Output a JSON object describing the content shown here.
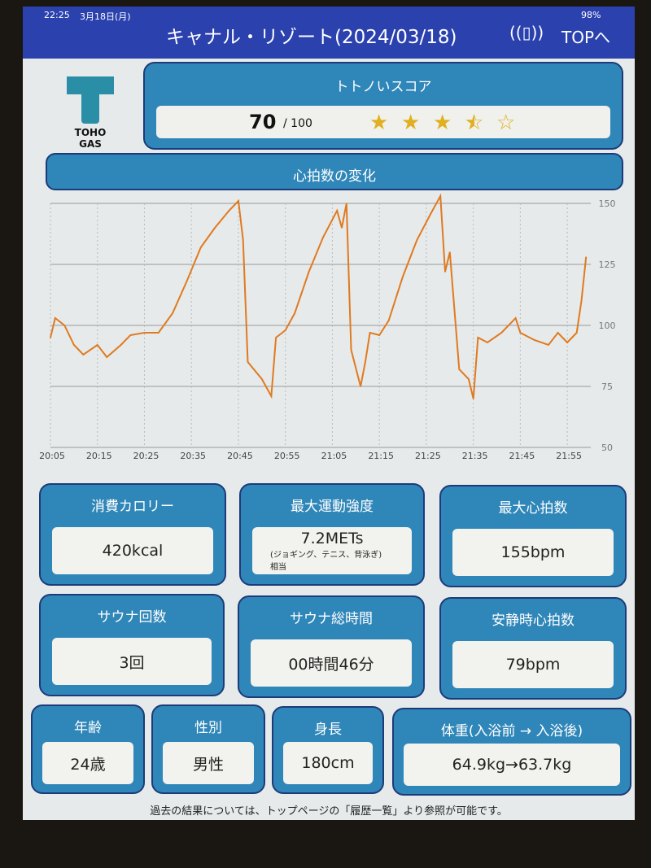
{
  "status": {
    "time": "22:25",
    "date": "3月18日(月)",
    "battery": "98%"
  },
  "header": {
    "title": "キャナル・リゾート(2024/03/18)",
    "watch_icon": "smartwatch-icon",
    "top_label": "TOPへ"
  },
  "logo": {
    "text": "TOHO GAS"
  },
  "score": {
    "title": "トトノいスコア",
    "value": "70",
    "max": "/ 100",
    "stars": 3.5,
    "star_color": "#e0b020"
  },
  "chart_section": {
    "title": "心拍数の変化"
  },
  "chart_data": {
    "type": "line",
    "color": "#e07a20",
    "ylim": [
      50,
      150
    ],
    "yticks": [
      50,
      75,
      100,
      125,
      150
    ],
    "xticks": [
      "20:05",
      "20:15",
      "20:25",
      "20:35",
      "20:45",
      "20:55",
      "21:05",
      "21:15",
      "21:25",
      "21:35",
      "21:45",
      "21:55"
    ],
    "x": [
      "20:05",
      "20:06",
      "20:08",
      "20:10",
      "20:12",
      "20:15",
      "20:17",
      "20:20",
      "20:22",
      "20:25",
      "20:28",
      "20:31",
      "20:34",
      "20:37",
      "20:40",
      "20:43",
      "20:45",
      "20:46",
      "20:47",
      "20:50",
      "20:52",
      "20:53",
      "20:55",
      "20:57",
      "21:00",
      "21:03",
      "21:06",
      "21:07",
      "21:08",
      "21:09",
      "21:11",
      "21:12",
      "21:13",
      "21:15",
      "21:17",
      "21:20",
      "21:23",
      "21:26",
      "21:28",
      "21:29",
      "21:30",
      "21:32",
      "21:34",
      "21:35",
      "21:36",
      "21:38",
      "21:41",
      "21:44",
      "21:45",
      "21:48",
      "21:51",
      "21:53",
      "21:55",
      "21:57",
      "21:58",
      "21:59"
    ],
    "y": [
      95,
      103,
      100,
      92,
      88,
      92,
      87,
      92,
      96,
      97,
      97,
      105,
      118,
      132,
      140,
      147,
      151,
      135,
      85,
      78,
      71,
      95,
      98,
      105,
      122,
      136,
      147,
      140,
      150,
      90,
      75,
      85,
      97,
      96,
      102,
      120,
      135,
      146,
      153,
      122,
      130,
      82,
      78,
      70,
      95,
      93,
      97,
      103,
      97,
      94,
      92,
      97,
      93,
      97,
      110,
      128
    ]
  },
  "stats": [
    {
      "label": "消費カロリー",
      "value": "420kcal"
    },
    {
      "label": "最大運動強度",
      "value": "7.2METs",
      "note": "(ジョギング、テニス、背泳ぎ)",
      "note2": "相当"
    },
    {
      "label": "最大心拍数",
      "value": "155bpm"
    },
    {
      "label": "サウナ回数",
      "value": "3回"
    },
    {
      "label": "サウナ総時間",
      "value": "00時間46分"
    },
    {
      "label": "安静時心拍数",
      "value": "79bpm"
    },
    {
      "label": "年齢",
      "value": "24歳"
    },
    {
      "label": "性別",
      "value": "男性"
    },
    {
      "label": "身長",
      "value": "180cm"
    },
    {
      "label": "体重(入浴前 → 入浴後)",
      "value": "64.9kg→63.7kg"
    }
  ],
  "footer": "過去の結果については、トップページの「履歴一覧」より参照が可能です。"
}
